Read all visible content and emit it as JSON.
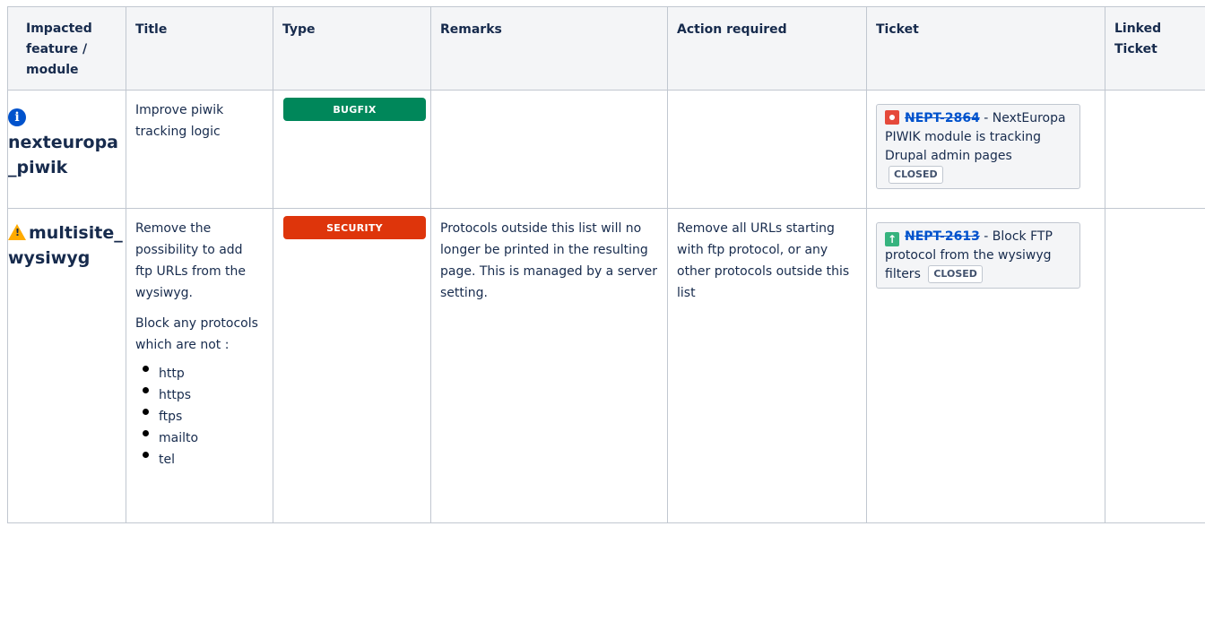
{
  "headers": {
    "impacted": "Impacted\nfeature /\nmodule",
    "title": "Title",
    "type": "Type",
    "remarks": "Remarks",
    "action": "Action required",
    "ticket": "Ticket",
    "linked": "Linked\nTicket"
  },
  "rows": [
    {
      "module": "nexteuropa_piwik",
      "module_icon": "info-icon",
      "title": "Improve piwik tracking logic",
      "type": "BUGFIX",
      "remarks": "",
      "action": "",
      "ticket_key": "NEPT-2864",
      "ticket_icon": "bug-icon",
      "ticket_summary": " - NextEuropa PIWIK module is tracking Drupal admin pages",
      "ticket_status": "CLOSED"
    },
    {
      "module": "multisite_wysiwyg",
      "module_icon": "warning-icon",
      "title_p1": "Remove the possibility to add ftp URLs from the wysiwyg.",
      "title_p2": "Block any protocols which are not :",
      "protocols": [
        "http",
        "https",
        "ftps",
        "mailto",
        "tel"
      ],
      "type": "SECURITY",
      "remarks": "Protocols outside this list will no longer be printed in the resulting page. This is managed by a server setting.",
      "action": "Remove all URLs starting with ftp protocol, or any other protocols outside this list",
      "ticket_key": "NEPT-2613",
      "ticket_icon": "improvement-icon",
      "ticket_summary": " - Block FTP protocol from the wysiwyg filters",
      "ticket_status": "CLOSED"
    }
  ],
  "colors": {
    "bugfix": "#00875a",
    "security": "#de350b",
    "link": "#0052cc",
    "header_bg": "#f4f5f7"
  }
}
